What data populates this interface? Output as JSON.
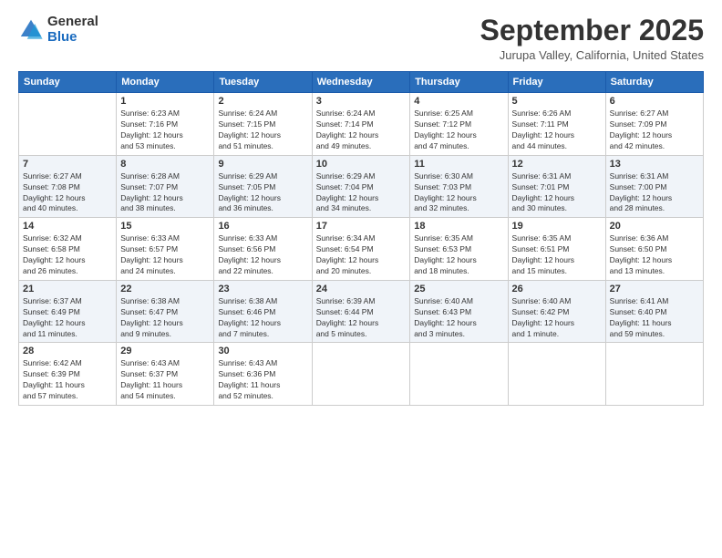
{
  "logo": {
    "general": "General",
    "blue": "Blue"
  },
  "title": "September 2025",
  "location": "Jurupa Valley, California, United States",
  "days_of_week": [
    "Sunday",
    "Monday",
    "Tuesday",
    "Wednesday",
    "Thursday",
    "Friday",
    "Saturday"
  ],
  "weeks": [
    [
      {
        "day": "",
        "info": ""
      },
      {
        "day": "1",
        "info": "Sunrise: 6:23 AM\nSunset: 7:16 PM\nDaylight: 12 hours\nand 53 minutes."
      },
      {
        "day": "2",
        "info": "Sunrise: 6:24 AM\nSunset: 7:15 PM\nDaylight: 12 hours\nand 51 minutes."
      },
      {
        "day": "3",
        "info": "Sunrise: 6:24 AM\nSunset: 7:14 PM\nDaylight: 12 hours\nand 49 minutes."
      },
      {
        "day": "4",
        "info": "Sunrise: 6:25 AM\nSunset: 7:12 PM\nDaylight: 12 hours\nand 47 minutes."
      },
      {
        "day": "5",
        "info": "Sunrise: 6:26 AM\nSunset: 7:11 PM\nDaylight: 12 hours\nand 44 minutes."
      },
      {
        "day": "6",
        "info": "Sunrise: 6:27 AM\nSunset: 7:09 PM\nDaylight: 12 hours\nand 42 minutes."
      }
    ],
    [
      {
        "day": "7",
        "info": "Sunrise: 6:27 AM\nSunset: 7:08 PM\nDaylight: 12 hours\nand 40 minutes."
      },
      {
        "day": "8",
        "info": "Sunrise: 6:28 AM\nSunset: 7:07 PM\nDaylight: 12 hours\nand 38 minutes."
      },
      {
        "day": "9",
        "info": "Sunrise: 6:29 AM\nSunset: 7:05 PM\nDaylight: 12 hours\nand 36 minutes."
      },
      {
        "day": "10",
        "info": "Sunrise: 6:29 AM\nSunset: 7:04 PM\nDaylight: 12 hours\nand 34 minutes."
      },
      {
        "day": "11",
        "info": "Sunrise: 6:30 AM\nSunset: 7:03 PM\nDaylight: 12 hours\nand 32 minutes."
      },
      {
        "day": "12",
        "info": "Sunrise: 6:31 AM\nSunset: 7:01 PM\nDaylight: 12 hours\nand 30 minutes."
      },
      {
        "day": "13",
        "info": "Sunrise: 6:31 AM\nSunset: 7:00 PM\nDaylight: 12 hours\nand 28 minutes."
      }
    ],
    [
      {
        "day": "14",
        "info": "Sunrise: 6:32 AM\nSunset: 6:58 PM\nDaylight: 12 hours\nand 26 minutes."
      },
      {
        "day": "15",
        "info": "Sunrise: 6:33 AM\nSunset: 6:57 PM\nDaylight: 12 hours\nand 24 minutes."
      },
      {
        "day": "16",
        "info": "Sunrise: 6:33 AM\nSunset: 6:56 PM\nDaylight: 12 hours\nand 22 minutes."
      },
      {
        "day": "17",
        "info": "Sunrise: 6:34 AM\nSunset: 6:54 PM\nDaylight: 12 hours\nand 20 minutes."
      },
      {
        "day": "18",
        "info": "Sunrise: 6:35 AM\nSunset: 6:53 PM\nDaylight: 12 hours\nand 18 minutes."
      },
      {
        "day": "19",
        "info": "Sunrise: 6:35 AM\nSunset: 6:51 PM\nDaylight: 12 hours\nand 15 minutes."
      },
      {
        "day": "20",
        "info": "Sunrise: 6:36 AM\nSunset: 6:50 PM\nDaylight: 12 hours\nand 13 minutes."
      }
    ],
    [
      {
        "day": "21",
        "info": "Sunrise: 6:37 AM\nSunset: 6:49 PM\nDaylight: 12 hours\nand 11 minutes."
      },
      {
        "day": "22",
        "info": "Sunrise: 6:38 AM\nSunset: 6:47 PM\nDaylight: 12 hours\nand 9 minutes."
      },
      {
        "day": "23",
        "info": "Sunrise: 6:38 AM\nSunset: 6:46 PM\nDaylight: 12 hours\nand 7 minutes."
      },
      {
        "day": "24",
        "info": "Sunrise: 6:39 AM\nSunset: 6:44 PM\nDaylight: 12 hours\nand 5 minutes."
      },
      {
        "day": "25",
        "info": "Sunrise: 6:40 AM\nSunset: 6:43 PM\nDaylight: 12 hours\nand 3 minutes."
      },
      {
        "day": "26",
        "info": "Sunrise: 6:40 AM\nSunset: 6:42 PM\nDaylight: 12 hours\nand 1 minute."
      },
      {
        "day": "27",
        "info": "Sunrise: 6:41 AM\nSunset: 6:40 PM\nDaylight: 11 hours\nand 59 minutes."
      }
    ],
    [
      {
        "day": "28",
        "info": "Sunrise: 6:42 AM\nSunset: 6:39 PM\nDaylight: 11 hours\nand 57 minutes."
      },
      {
        "day": "29",
        "info": "Sunrise: 6:43 AM\nSunset: 6:37 PM\nDaylight: 11 hours\nand 54 minutes."
      },
      {
        "day": "30",
        "info": "Sunrise: 6:43 AM\nSunset: 6:36 PM\nDaylight: 11 hours\nand 52 minutes."
      },
      {
        "day": "",
        "info": ""
      },
      {
        "day": "",
        "info": ""
      },
      {
        "day": "",
        "info": ""
      },
      {
        "day": "",
        "info": ""
      }
    ]
  ]
}
